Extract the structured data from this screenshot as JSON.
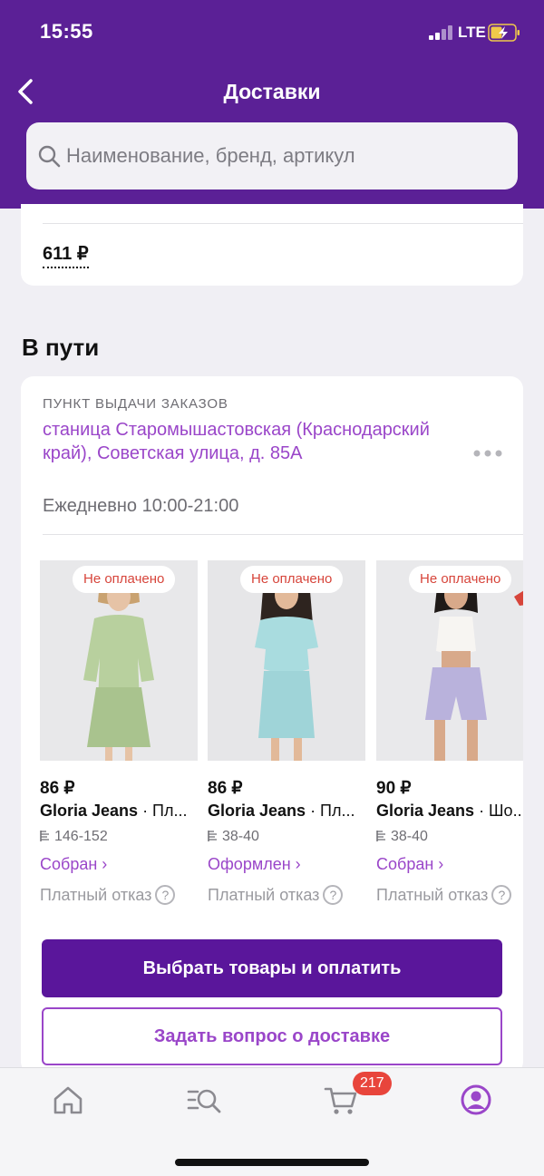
{
  "status_bar": {
    "time": "15:55",
    "network": "LTE"
  },
  "header": {
    "title": "Доставки"
  },
  "search": {
    "placeholder": "Наименование, бренд, артикул"
  },
  "previous_card": {
    "total_price": "611 ₽"
  },
  "in_transit": {
    "title": "В пути",
    "pickup_label": "ПУНКТ ВЫДАЧИ ЗАКАЗОВ",
    "address": "станица Старомышастовская (Краснодарский край), Советская улица, д. 85А",
    "hours": "Ежедневно 10:00-21:00",
    "products": [
      {
        "tag": "Не оплачено",
        "price": "86 ₽",
        "brand": "Gloria Jeans",
        "name_suffix": " · Пл...",
        "size": "146-152",
        "status": "Собран ›",
        "refusal": "Платный отказ",
        "image": "green-dress-photo"
      },
      {
        "tag": "Не оплачено",
        "price": "86 ₽",
        "brand": "Gloria Jeans",
        "name_suffix": " · Пл...",
        "size": "38-40",
        "status": "Оформлен ›",
        "refusal": "Платный отказ",
        "image": "mint-dress-photo"
      },
      {
        "tag": "Не оплачено",
        "price": "90 ₽",
        "brand": "Gloria Jeans",
        "name_suffix": " · Шо...",
        "size": "38-40",
        "status": "Собран ›",
        "refusal": "Платный отказ",
        "image": "shorts-top-photo"
      }
    ],
    "primary_button": "Выбрать товары и оплатить",
    "secondary_button": "Задать вопрос о доставке"
  },
  "tab_bar": {
    "items": [
      "home-icon",
      "catalog-search-icon",
      "cart-icon",
      "profile-icon"
    ],
    "cart_count": "217",
    "active": "profile-icon"
  },
  "colors": {
    "header_bg": "#5b2096",
    "accent": "#9a46c9",
    "primary_button": "#5a169b",
    "unpaid_tag": "#d7453b",
    "badge": "#e8453c"
  }
}
